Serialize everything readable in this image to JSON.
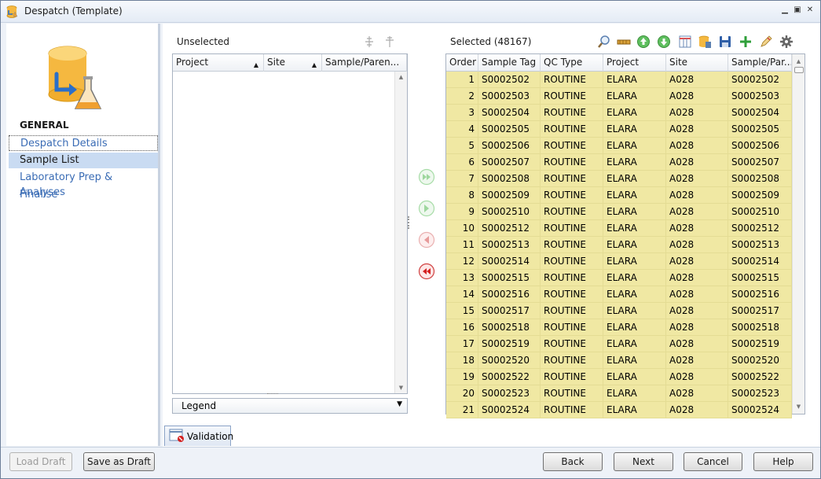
{
  "window": {
    "title": "Despatch (Template)"
  },
  "sidebar": {
    "heading": "GENERAL",
    "items": [
      {
        "label": "Despatch Details"
      },
      {
        "label": "Sample List"
      },
      {
        "label": "Laboratory Prep & Analyses"
      },
      {
        "label": "Finalise"
      }
    ]
  },
  "unselected": {
    "label": "Unselected",
    "columns": [
      "Project",
      "Site",
      "Sample/Paren..."
    ],
    "legend_label": "Legend"
  },
  "selected": {
    "label": "Selected (48167)",
    "columns": [
      "Order",
      "Sample Tag",
      "QC Type",
      "Project",
      "Site",
      "Sample/Par..."
    ],
    "rows": [
      [
        "1",
        "S0002502",
        "ROUTINE",
        "ELARA",
        "A028",
        "S0002502"
      ],
      [
        "2",
        "S0002503",
        "ROUTINE",
        "ELARA",
        "A028",
        "S0002503"
      ],
      [
        "3",
        "S0002504",
        "ROUTINE",
        "ELARA",
        "A028",
        "S0002504"
      ],
      [
        "4",
        "S0002505",
        "ROUTINE",
        "ELARA",
        "A028",
        "S0002505"
      ],
      [
        "5",
        "S0002506",
        "ROUTINE",
        "ELARA",
        "A028",
        "S0002506"
      ],
      [
        "6",
        "S0002507",
        "ROUTINE",
        "ELARA",
        "A028",
        "S0002507"
      ],
      [
        "7",
        "S0002508",
        "ROUTINE",
        "ELARA",
        "A028",
        "S0002508"
      ],
      [
        "8",
        "S0002509",
        "ROUTINE",
        "ELARA",
        "A028",
        "S0002509"
      ],
      [
        "9",
        "S0002510",
        "ROUTINE",
        "ELARA",
        "A028",
        "S0002510"
      ],
      [
        "10",
        "S0002512",
        "ROUTINE",
        "ELARA",
        "A028",
        "S0002512"
      ],
      [
        "11",
        "S0002513",
        "ROUTINE",
        "ELARA",
        "A028",
        "S0002513"
      ],
      [
        "12",
        "S0002514",
        "ROUTINE",
        "ELARA",
        "A028",
        "S0002514"
      ],
      [
        "13",
        "S0002515",
        "ROUTINE",
        "ELARA",
        "A028",
        "S0002515"
      ],
      [
        "14",
        "S0002516",
        "ROUTINE",
        "ELARA",
        "A028",
        "S0002516"
      ],
      [
        "15",
        "S0002517",
        "ROUTINE",
        "ELARA",
        "A028",
        "S0002517"
      ],
      [
        "16",
        "S0002518",
        "ROUTINE",
        "ELARA",
        "A028",
        "S0002518"
      ],
      [
        "17",
        "S0002519",
        "ROUTINE",
        "ELARA",
        "A028",
        "S0002519"
      ],
      [
        "18",
        "S0002520",
        "ROUTINE",
        "ELARA",
        "A028",
        "S0002520"
      ],
      [
        "19",
        "S0002522",
        "ROUTINE",
        "ELARA",
        "A028",
        "S0002522"
      ],
      [
        "20",
        "S0002523",
        "ROUTINE",
        "ELARA",
        "A028",
        "S0002523"
      ],
      [
        "21",
        "S0002524",
        "ROUTINE",
        "ELARA",
        "A028",
        "S0002524"
      ]
    ]
  },
  "tabs": {
    "validation": "Validation"
  },
  "buttons": {
    "load_draft": "Load Draft",
    "save_as_draft": "Save as Draft",
    "back": "Back",
    "next": "Next",
    "cancel": "Cancel",
    "help": "Help"
  },
  "colors": {
    "row_highlight": "#f0e8a3",
    "accent": "#3a6cb5"
  }
}
